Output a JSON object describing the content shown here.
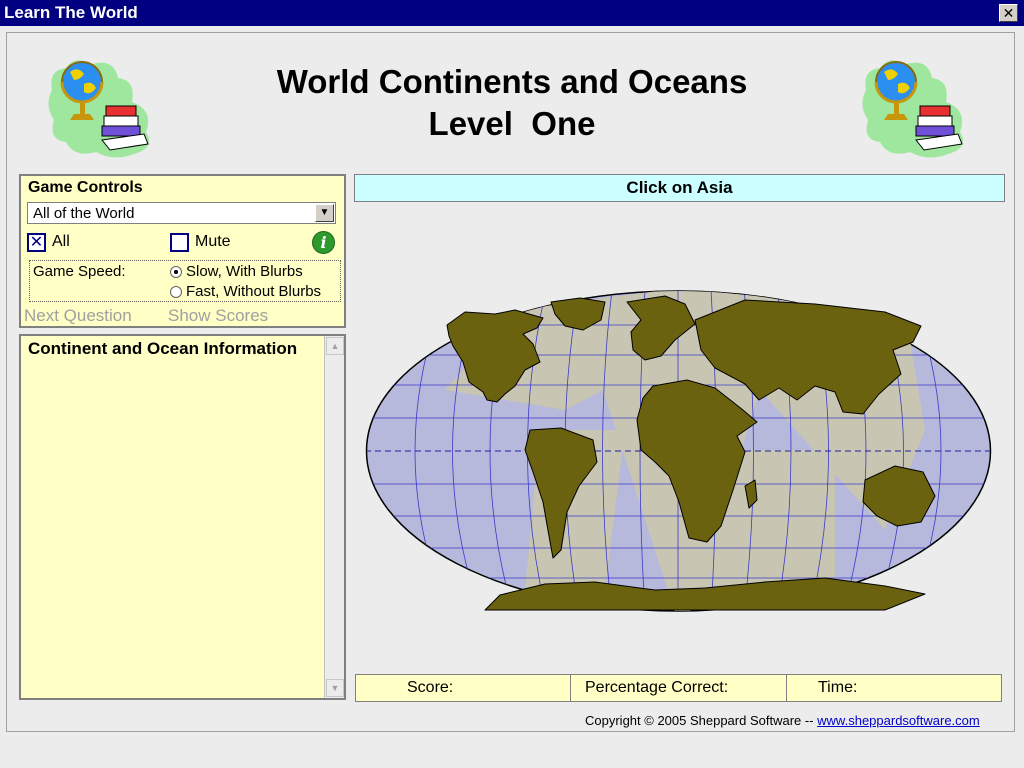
{
  "window": {
    "title": "Learn The World",
    "close_glyph": "✕"
  },
  "heading": {
    "line1": "World Continents and Oceans",
    "line2": "Level  One"
  },
  "game_controls": {
    "title": "Game Controls",
    "region_select": {
      "value": "All of the World",
      "arrow": "▼"
    },
    "all_checkbox": {
      "label": "All",
      "checked": true,
      "mark": "✕"
    },
    "mute_checkbox": {
      "label": "Mute",
      "checked": false
    },
    "info_icon": "i",
    "speed": {
      "label": "Game Speed:",
      "options": [
        {
          "label": "Slow, With Blurbs",
          "selected": true
        },
        {
          "label": "Fast, Without Blurbs",
          "selected": false
        }
      ]
    },
    "next_question": "Next Question",
    "show_scores": "Show Scores"
  },
  "info_panel": {
    "title": "Continent and Ocean Information",
    "scroll_up": "▲",
    "scroll_down": "▼"
  },
  "prompt": "Click on Asia",
  "scorebar": {
    "score_label": "Score:",
    "percent_label": "Percentage Correct:",
    "time_label": "Time:"
  },
  "footer": {
    "copyright": "Copyright © 2005 Sheppard Software -- ",
    "link": "www.sheppardsoftware.com"
  },
  "colors": {
    "titlebar": "#000080",
    "panel": "#ffffc6",
    "prompt": "#ccffff",
    "ocean": "#b6b8dc",
    "land": "#6b6210",
    "antarctica_wedge": "#c8c6b2",
    "grid": "#3a3ac8"
  }
}
